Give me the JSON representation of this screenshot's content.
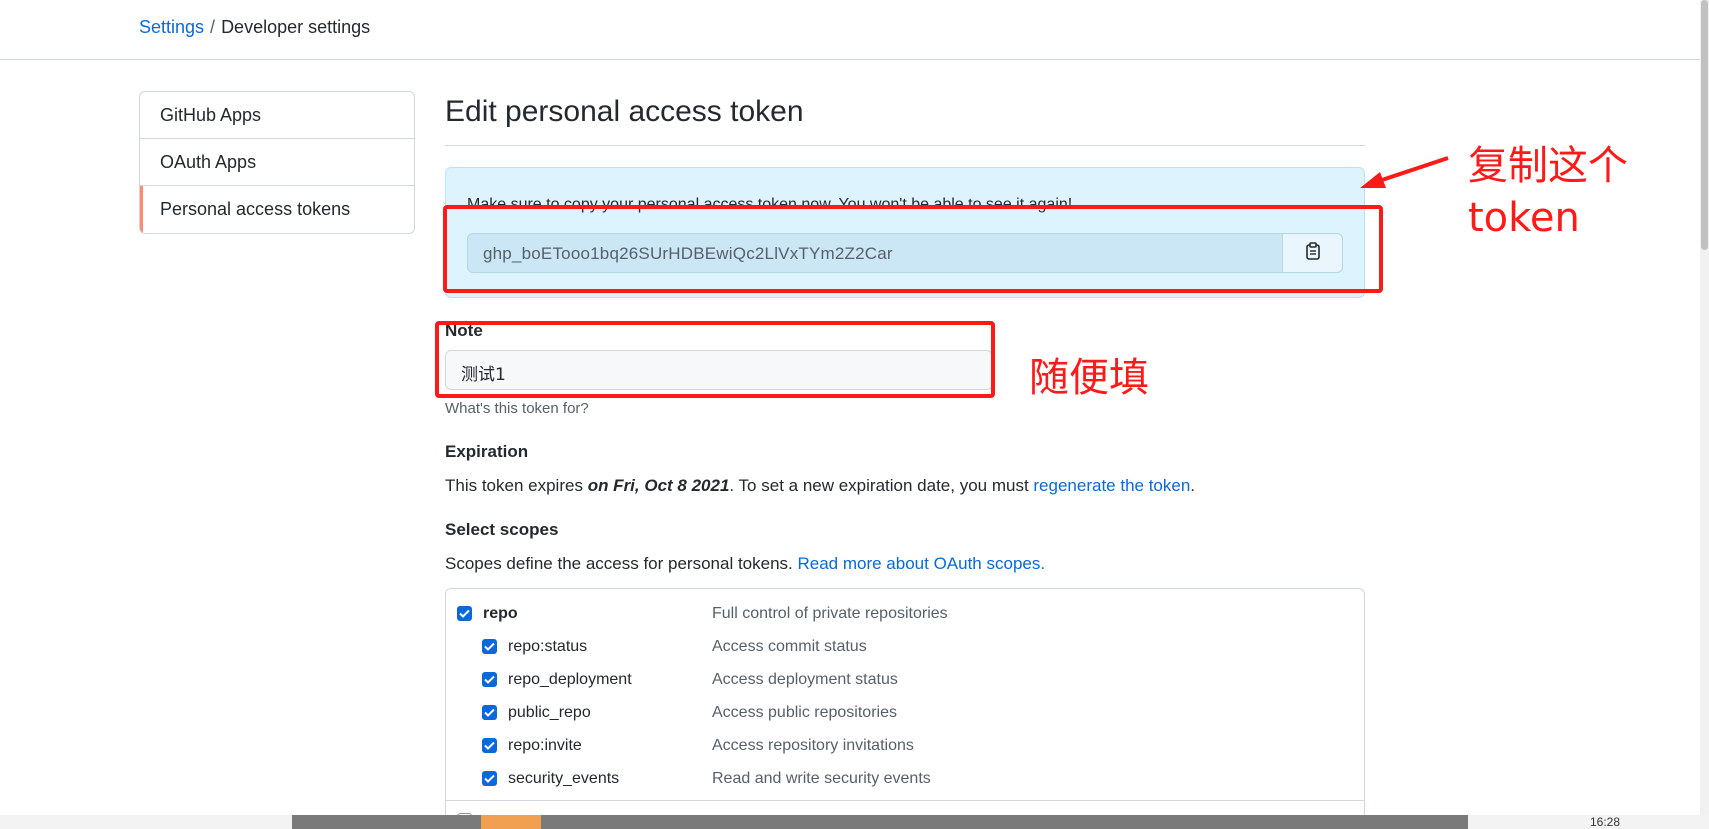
{
  "breadcrumb": {
    "settings": "Settings",
    "separator": "/",
    "current": "Developer settings"
  },
  "sidebar": {
    "items": [
      {
        "label": "GitHub Apps"
      },
      {
        "label": "OAuth Apps"
      },
      {
        "label": "Personal access tokens",
        "selected": true
      }
    ]
  },
  "main": {
    "title": "Edit personal access token",
    "flash": {
      "message": "Make sure to copy your personal access token now. You won't be able to see it again!",
      "token": "ghp_boETooo1bq26SUrHDBEwiQc2LlVxTYm2Z2Car",
      "copy_icon": "clipboard-icon"
    },
    "note": {
      "label": "Note",
      "value": "测试1",
      "hint": "What's this token for?"
    },
    "expiration": {
      "label": "Expiration",
      "text_before": "This token expires ",
      "date": "on Fri, Oct 8 2021",
      "text_after": ". To set a new expiration date, you must ",
      "link": "regenerate the token",
      "text_end": "."
    },
    "scopes": {
      "label": "Select scopes",
      "description": "Scopes define the access for personal tokens. ",
      "link": "Read more about OAuth scopes.",
      "items": [
        {
          "name": "repo",
          "desc": "Full control of private repositories",
          "checked": true
        },
        {
          "name": "repo:status",
          "desc": "Access commit status",
          "checked": true
        },
        {
          "name": "repo_deployment",
          "desc": "Access deployment status",
          "checked": true
        },
        {
          "name": "public_repo",
          "desc": "Access public repositories",
          "checked": true
        },
        {
          "name": "repo:invite",
          "desc": "Access repository invitations",
          "checked": true
        },
        {
          "name": "security_events",
          "desc": "Read and write security events",
          "checked": true
        }
      ]
    }
  },
  "annotations": {
    "copy_token_line1": "复制这个",
    "copy_token_line2": "token",
    "fill_anything": "随便填"
  },
  "taskbar": {
    "clock": "16:28"
  },
  "colors": {
    "link": "#0969da",
    "annotation": "#ff1a1a",
    "flash_bg": "#ddf4ff",
    "checkbox": "#0969da",
    "sidebar_selected": "#fd8c73"
  }
}
